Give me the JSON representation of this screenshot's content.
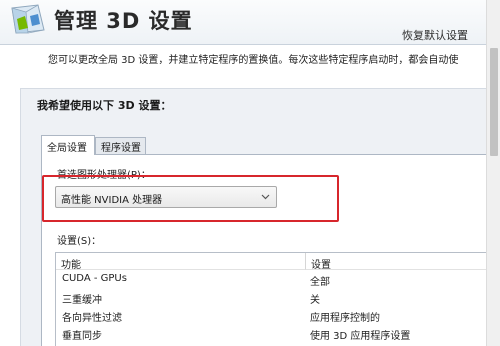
{
  "window": {
    "title": "管理 3D 设置",
    "restore_defaults": "恢复默认设置",
    "description": "您可以更改全局 3D 设置，并建立特定程序的置换值。每次这些特定程序启动时，都会自动使",
    "logo_icon": "nvidia-3d-cube-icon"
  },
  "panel": {
    "heading": "我希望使用以下 3D 设置："
  },
  "tabs": [
    {
      "label": "全局设置",
      "active": true
    },
    {
      "label": "程序设置",
      "active": false
    }
  ],
  "gpu": {
    "label": "首选图形处理器(P)：",
    "selected": "高性能 NVIDIA 处理器",
    "highlight_color": "#d7262c"
  },
  "settings": {
    "label": "设置(S)：",
    "columns": [
      "功能",
      "设置"
    ],
    "rows": [
      {
        "feature": "CUDA - GPUs",
        "value": "全部"
      },
      {
        "feature": "三重缓冲",
        "value": "关"
      },
      {
        "feature": "各向异性过滤",
        "value": "应用程序控制的"
      },
      {
        "feature": "垂直同步",
        "value": "使用 3D 应用程序设置"
      }
    ]
  }
}
